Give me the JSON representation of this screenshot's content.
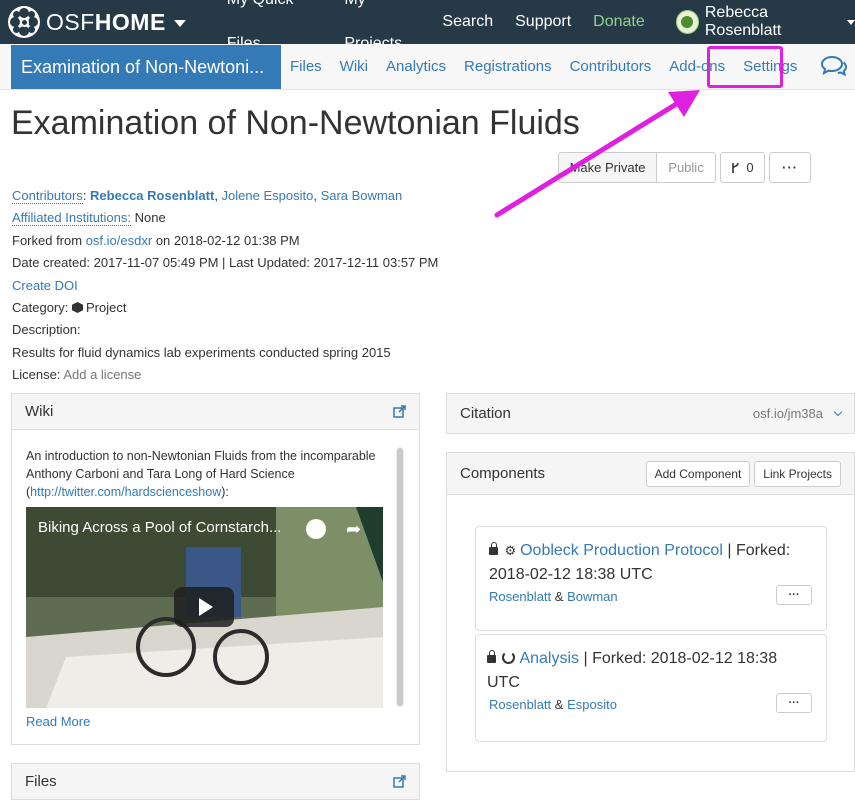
{
  "topnav": {
    "brand_osf": "OSF",
    "brand_home": "HOME",
    "links": [
      "My Quick Files",
      "My Projects",
      "Search",
      "Support",
      "Donate"
    ],
    "user_name": "Rebecca Rosenblatt"
  },
  "projnav": {
    "title": "Examination of Non-Newtoni...",
    "links": [
      "Files",
      "Wiki",
      "Analytics",
      "Registrations",
      "Contributors",
      "Add-ons",
      "Settings"
    ]
  },
  "project": {
    "title": "Examination of Non-Newtonian Fluids",
    "actions": {
      "make_private": "Make Private",
      "public": "Public",
      "fork_count": "0",
      "more": "···"
    },
    "contributors_label": "Contributors",
    "contributors": [
      "Rebecca Rosenblatt",
      "Jolene Esposito",
      "Sara Bowman"
    ],
    "affiliated_label": "Affiliated Institutions:",
    "affiliated_value": "None",
    "forked_from_prefix": "Forked from",
    "forked_from_link": "osf.io/esdxr",
    "forked_from_suffix": "on 2018-02-12 01:38 PM",
    "dates": "Date created: 2017-11-07 05:49 PM | Last Updated: 2017-12-11 03:57 PM",
    "create_doi": "Create DOI",
    "category_label": "Category:",
    "category_value": "Project",
    "description_label": "Description:",
    "description_value": "Results for fluid dynamics lab experiments conducted spring 2015",
    "license_label": "License:",
    "license_value": "Add a license"
  },
  "wiki": {
    "title": "Wiki",
    "text_before": "An introduction to non-Newtonian Fluids from the incomparable Anthony Carboni and Tara Long of Hard Science (",
    "text_link": "http://twitter.com/hardscienceshow",
    "text_after": "):",
    "video_title": "Biking Across a Pool of Cornstarch...",
    "read_more": "Read More"
  },
  "files": {
    "title": "Files"
  },
  "citation": {
    "title": "Citation",
    "link": "osf.io/jm38a"
  },
  "components": {
    "title": "Components",
    "add_component": "Add Component",
    "link_projects": "Link Projects",
    "items": [
      {
        "name": "Oobleck Production Protocol",
        "forked": "| Forked: 2018-02-12 18:38 UTC",
        "author1": "Rosenblatt",
        "author2": "Bowman",
        "more": "···"
      },
      {
        "name": "Analysis",
        "forked": "| Forked: 2018-02-12 18:38 UTC",
        "author1": "Rosenblatt",
        "author2": "Esposito",
        "more": "···"
      }
    ]
  },
  "colors": {
    "navbar": "#263947",
    "accent": "#337ab7",
    "donate": "#8fd18d",
    "highlight": "#e020e0"
  }
}
